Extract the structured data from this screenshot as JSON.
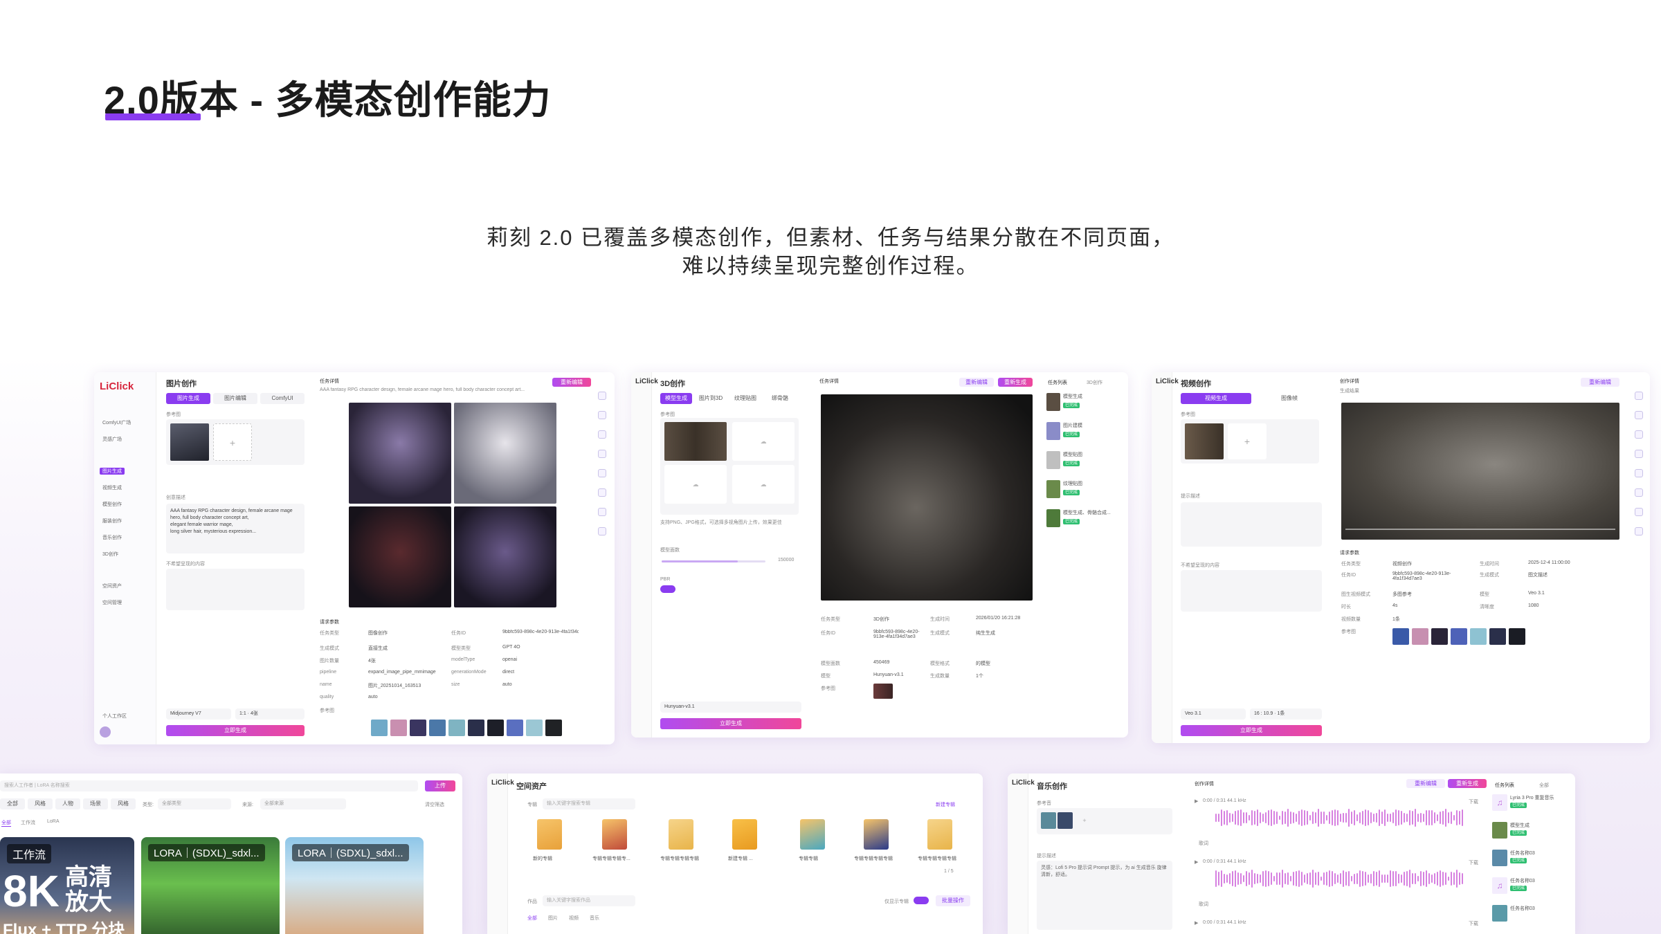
{
  "slide": {
    "title": "2.0版本 - 多模态创作能力",
    "subtitle_line1": "莉刻 2.0 已覆盖多模态创作，但素材、任务与结果分散在不同页面，",
    "subtitle_line2": "难以持续呈现完整创作过程。",
    "accent": "#8a3cf0"
  },
  "image_panel": {
    "logo": "LiClick",
    "title": "图片创作",
    "tabs": [
      "图片生成",
      "图片编辑",
      "ComfyUI"
    ],
    "nav": [
      "ComfyUI广场",
      "灵感广场",
      "图片生成",
      "视频生成",
      "模型创作",
      "服装创作",
      "音乐创作",
      "3D创作",
      "空间资产",
      "空间管理"
    ],
    "ref_label": "参考图",
    "prompt_label": "创意描述",
    "prompt_lines": [
      "AAA fantasy RPG character design, female arcane mage",
      "hero, full body character concept art,",
      "elegant female warrior mage,",
      "long silver hair, mysterious expression..."
    ],
    "neg_label": "不希望呈现的内容",
    "model_select": "Midjourney V7",
    "ratio_select": "1:1 · 4张",
    "workspace": "个人工作区",
    "generate": "立即生成",
    "detail_title": "任务详情",
    "detail_prompt": "AAA fantasy RPG character design, female arcane mage hero, full body character concept art...",
    "reedit": "重新编辑",
    "params_title": "请求参数",
    "params": [
      [
        "任务类型",
        "图像创作",
        "任务ID",
        "9bbfc593-898c-4e20-913e-4fa1f34d7ae3"
      ],
      [
        "生成模式",
        "直接生成",
        "模型类型",
        "GPT 4O"
      ],
      [
        "图片数量",
        "4张",
        "modelType",
        "openai"
      ],
      [
        "pipeline",
        "expand_image_pipe_mmimage",
        "generationMode",
        "direct"
      ],
      [
        "name",
        "图片_20251014_163513",
        "size",
        "auto"
      ],
      [
        "quality",
        "auto",
        "",
        ""
      ]
    ],
    "ref_images_label": "参考图"
  },
  "d3_panel": {
    "logo": "LiClick",
    "title": "3D创作",
    "tabs": [
      "模型生成",
      "图片到3D",
      "纹理贴图",
      "绑骨骼"
    ],
    "ref_label": "参考图",
    "hint": "支持PNG、JPG格式，可选择多视角图片上传，效果更佳",
    "scale_label": "模型面数",
    "scale_value": "150000",
    "pbr_label": "PBR",
    "model_select": "Hunyuan-v3.1",
    "generate": "立即生成",
    "detail_title": "任务详情",
    "reedit": "重新编辑",
    "regen": "重新生成",
    "params": [
      [
        "任务类型",
        "3D创作",
        "生成时间",
        "2026/01/20 16:21:28"
      ],
      [
        "任务ID",
        "9bbfc593-898c-4e20-913e-4fa1f34d7ae3",
        "生成模式",
        "纯生生成"
      ],
      [
        "模型面数",
        "450469",
        "模型格式",
        "的模型"
      ],
      [
        "模型",
        "Hunyuan-v3.1",
        "生成数量",
        "1个"
      ],
      [
        "参考图",
        "",
        ""
      ]
    ],
    "task_list_title": "任务列表",
    "task_filter": "3D创作",
    "tasks": [
      "模型生成",
      "图片建模",
      "模型贴图",
      "纹理贴图",
      "模型生成、骨骼合成..."
    ],
    "chip": "已完成"
  },
  "video_panel": {
    "logo": "LiClick",
    "title": "视频创作",
    "tabs": [
      "视频生成",
      "图像帧"
    ],
    "ref_label": "参考图",
    "prompt_label": "提示描述",
    "neg_label": "不希望呈现的内容",
    "model_select": "Veo 3.1",
    "ratio_select": "16 : 10.9 · 1条",
    "generate": "立即生成",
    "detail_title": "创作详情",
    "result_label": "生成结果",
    "reedit": "重新编辑",
    "params_title": "请求参数",
    "params": [
      [
        "任务类型",
        "视频创作",
        "生成时间",
        "2025-12-4 11:00:00"
      ],
      [
        "任务ID",
        "9bbfc593-898c-4e20-913e-4fa1f34d7ae3",
        "生成模式",
        "图文描述"
      ],
      [
        "图生视频模式",
        "多图参考",
        "模型",
        "Veo 3.1"
      ],
      [
        "时长",
        "4s",
        "清晰度",
        "1080"
      ],
      [
        "视频数量",
        "1条",
        "",
        ""
      ],
      [
        "参考图",
        "",
        ""
      ]
    ]
  },
  "gallery_panel": {
    "search_placeholder": "搜索人工作者 | LoRA 名称搜索",
    "upload": "上传",
    "filters": [
      "全部",
      "风格",
      "人物",
      "场景",
      "风格"
    ],
    "category_label": "类型:",
    "category_value": "全部类型",
    "source_label": "来源:",
    "source_value": "全部来源",
    "clear": "清空筛选",
    "tabs": [
      "全部",
      "工作流",
      "LoRA"
    ],
    "cards": [
      {
        "tag": "工作流",
        "title1": "8K",
        "title2": "高清",
        "title3": "放大",
        "title4": "Flux + TTP 分块"
      },
      {
        "tag": "LORA｜(SDXL)_sdxl..."
      },
      {
        "tag": "LORA｜(SDXL)_sdxl..."
      }
    ]
  },
  "assets_panel": {
    "logo": "LiClick",
    "title": "空间资产",
    "folder_tab": "专辑",
    "search_placeholder": "输入关键字搜索专辑",
    "new_album": "新建专辑",
    "folders": [
      "新的专辑",
      "专辑专辑专辑专...",
      "专辑专辑专辑专辑",
      "新建专辑 ...",
      "专辑专辑",
      "专辑专辑专辑专辑",
      "专辑专辑专辑专辑"
    ],
    "pager": "1 / 5",
    "works_label": "作品",
    "works_search": "输入关键字搜索作品",
    "only_mine": "仅显示专辑",
    "batch": "批量操作",
    "work_tabs": [
      "全部",
      "图片",
      "视频",
      "音乐"
    ]
  },
  "music_panel": {
    "logo": "LiClick",
    "title": "音乐创作",
    "ref_label": "参考音",
    "prompt_label": "提示描述",
    "prompt_text": "灵感：Lofi 5 Pro 提示词 Prompt 提示，为 ai 生成音乐 旋律清新，舒适。",
    "detail_title": "创作详情",
    "reedit": "重新编辑",
    "regen": "重新生成",
    "tracks": [
      {
        "time": "0:00 / 0:31  44.1 kHz",
        "label": "歌词",
        "dl": "下载"
      },
      {
        "time": "0:00 / 0:31  44.1 kHz",
        "label": "歌词",
        "dl": "下载"
      },
      {
        "time": "0:00 / 0:31  44.1 kHz",
        "label": "",
        "dl": "下载"
      }
    ],
    "task_list_title": "任务列表",
    "task_filter": "全部",
    "tasks": [
      "Lyria 3 Pro 重复音乐",
      "模型生成",
      "任务名称03",
      "任务名称03",
      "任务名称03"
    ],
    "chip": "已完成"
  }
}
